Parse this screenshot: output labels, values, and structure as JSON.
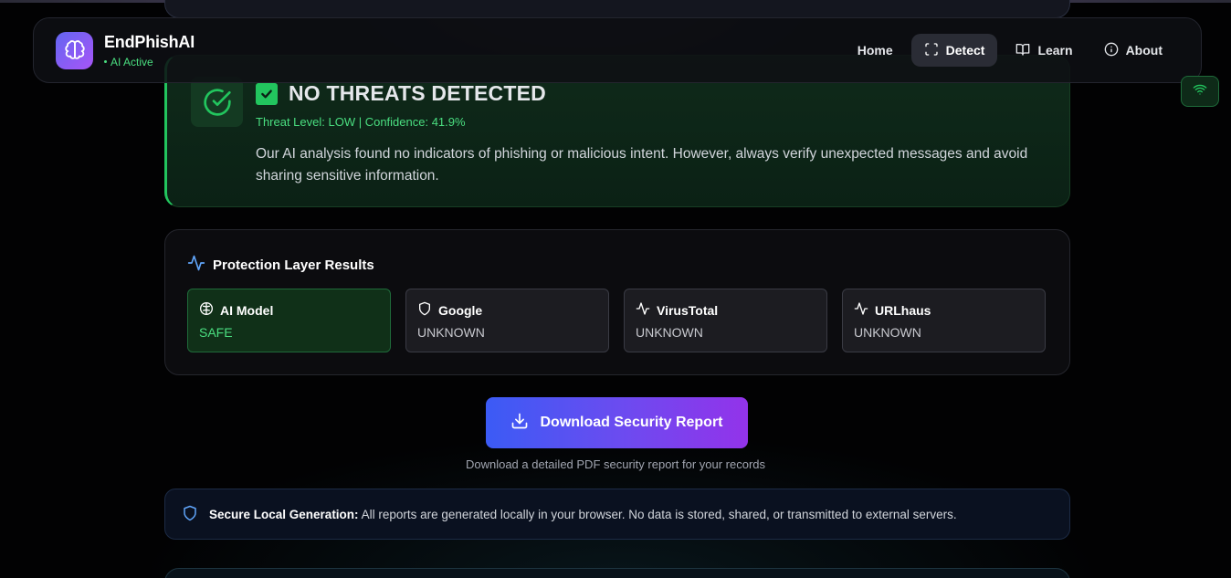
{
  "app": {
    "name": "EndPhishAI",
    "status": "AI Active"
  },
  "nav": {
    "items": [
      {
        "label": "Home",
        "icon": "none"
      },
      {
        "label": "Detect",
        "icon": "scan-icon",
        "active": true
      },
      {
        "label": "Learn",
        "icon": "book-icon"
      },
      {
        "label": "About",
        "icon": "info-icon"
      }
    ]
  },
  "result": {
    "heading": "NO THREATS DETECTED",
    "meta": "Threat Level: LOW | Confidence: 41.9%",
    "description": "Our AI analysis found no indicators of phishing or malicious intent. However, always verify unexpected messages and avoid sharing sensitive information."
  },
  "layers": {
    "title": "Protection Layer Results",
    "items": [
      {
        "name": "AI Model",
        "status": "SAFE",
        "icon": "brain-icon"
      },
      {
        "name": "Google",
        "status": "UNKNOWN",
        "icon": "shield-icon"
      },
      {
        "name": "VirusTotal",
        "status": "UNKNOWN",
        "icon": "activity-icon"
      },
      {
        "name": "URLhaus",
        "status": "UNKNOWN",
        "icon": "activity-icon"
      }
    ]
  },
  "download": {
    "button_label": "Download Security Report",
    "note": "Download a detailed PDF security report for your records"
  },
  "secure_notice": {
    "label": "Secure Local Generation:",
    "text": " All reports are generated locally in your browser. No data is stored, shared, or transmitted to external servers."
  },
  "colors": {
    "safe": "#22c55e",
    "accent_start": "#3b5bf5",
    "accent_end": "#9333ea"
  }
}
